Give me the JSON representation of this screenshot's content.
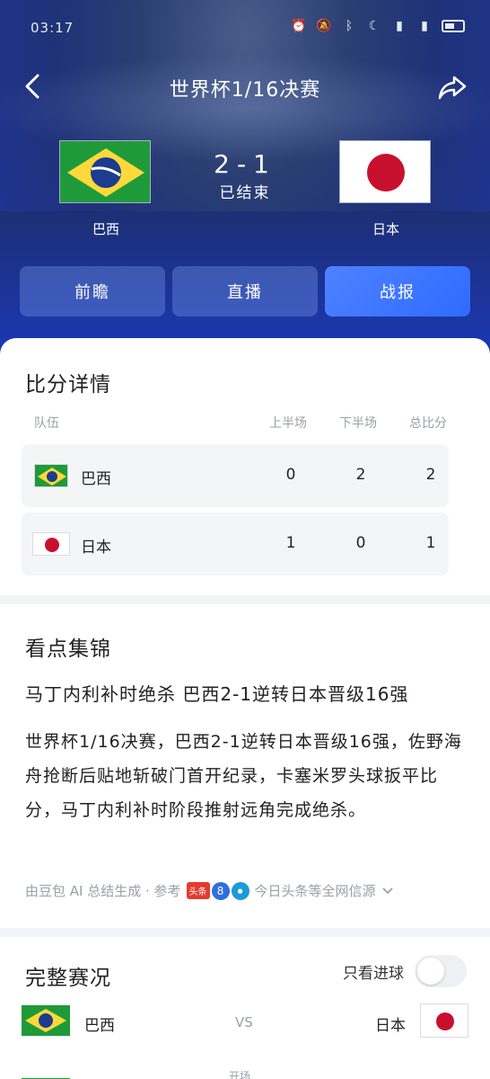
{
  "status_bar": {
    "time": "03:17"
  },
  "nav": {
    "title": "世界杯1/16决赛"
  },
  "match": {
    "home_name": "巴西",
    "away_name": "日本",
    "score": "2-1",
    "status": "已结束"
  },
  "tabs": [
    {
      "label": "前瞻",
      "active": false
    },
    {
      "label": "直播",
      "active": false
    },
    {
      "label": "战报",
      "active": true
    }
  ],
  "score_detail": {
    "title": "比分详情",
    "headers": {
      "team": "队伍",
      "first_half": "上半场",
      "second_half": "下半场",
      "total": "总比分"
    },
    "rows": [
      {
        "team": "巴西",
        "first_half": "0",
        "second_half": "2",
        "total": "2"
      },
      {
        "team": "日本",
        "first_half": "1",
        "second_half": "0",
        "total": "1"
      }
    ]
  },
  "highlights": {
    "title": "看点集锦",
    "headline": "马丁内利补时绝杀 巴西2-1逆转日本晋级16强",
    "summary": "世界杯1/16决赛，巴西2-1逆转日本晋级16强，佐野海舟抢断后贴地斩破门首开纪录，卡塞米罗头球扳平比分，马丁内利补时阶段推射远角完成绝杀。",
    "source_prefix": "由豆包 AI 总结生成 · 参考",
    "source_suffix": "今日头条等全网信源"
  },
  "full_match": {
    "title": "完整赛况",
    "toggle_label": "只看进球",
    "toggle_on": false,
    "home": "巴西",
    "vs": "VS",
    "away": "日本",
    "peek_text": "开场"
  },
  "colors": {
    "accent": "#2f6bff",
    "brazil_green": "#1f9a3a",
    "brazil_yellow": "#ffd83a",
    "brazil_blue": "#1d3b8f",
    "japan_red": "#c8102e"
  }
}
